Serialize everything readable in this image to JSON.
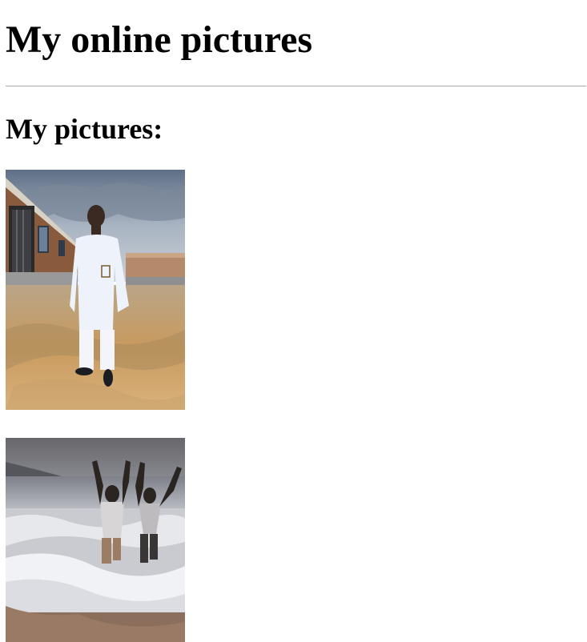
{
  "page": {
    "heading": "My online pictures",
    "section_heading": "My pictures:"
  },
  "pictures": [
    {
      "subject": "man in white outfit standing outdoors",
      "icon": "photo"
    },
    {
      "subject": "two people jumping in ocean waves",
      "icon": "photo"
    }
  ],
  "colors": {
    "text": "#000000",
    "rule": "#a9a9a9",
    "background": "#ffffff"
  }
}
